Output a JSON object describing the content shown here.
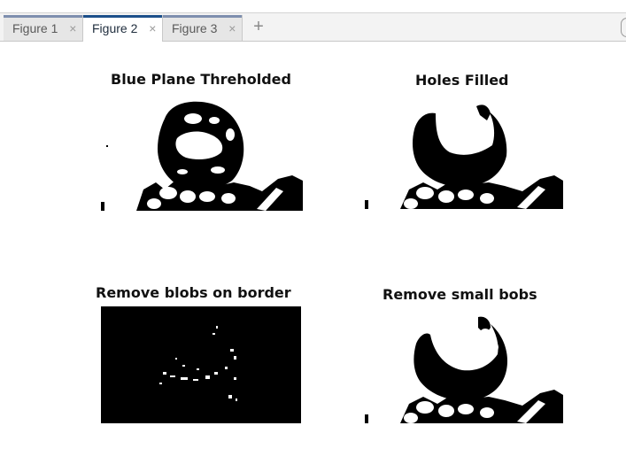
{
  "tabs": [
    {
      "label": "Figure 1",
      "close": "×",
      "active": false
    },
    {
      "label": "Figure 2",
      "close": "×",
      "active": true
    },
    {
      "label": "Figure 3",
      "close": "×",
      "active": false
    }
  ],
  "add_tab_label": "+",
  "figure": {
    "panels": [
      {
        "title": "Blue Plane Threholded"
      },
      {
        "title": "Holes Filled"
      },
      {
        "title": "Remove blobs on border"
      },
      {
        "title": "Remove small bobs"
      }
    ]
  },
  "colors": {
    "accent_active": "#1c4f8a",
    "accent_inactive": "#7e8fae",
    "foreground": "#000000",
    "background": "#ffffff"
  },
  "icons": {
    "close": "close-icon",
    "add": "plus-icon"
  }
}
